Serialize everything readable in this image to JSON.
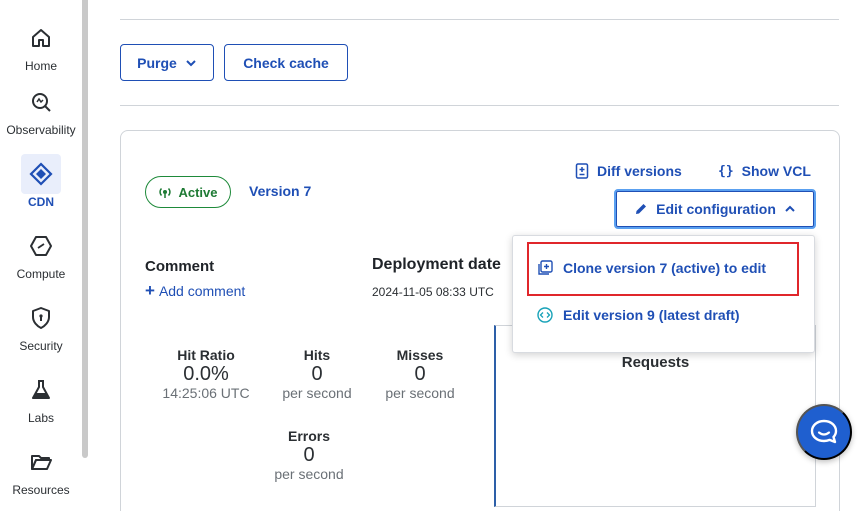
{
  "sidebar": {
    "items": [
      {
        "label": "Home",
        "icon": "home-icon"
      },
      {
        "label": "Observability",
        "icon": "magnifier-icon"
      },
      {
        "label": "CDN",
        "icon": "cdn-diamond-icon",
        "active": true
      },
      {
        "label": "Compute",
        "icon": "compute-hexagon-icon"
      },
      {
        "label": "Security",
        "icon": "shield-icon"
      },
      {
        "label": "Labs",
        "icon": "flask-icon"
      },
      {
        "label": "Resources",
        "icon": "folder-icon"
      }
    ]
  },
  "toolbar": {
    "purge_label": "Purge",
    "check_cache_label": "Check cache"
  },
  "service": {
    "status_label": "Active",
    "version_label": "Version 7",
    "diff_label": "Diff versions",
    "show_vcl_label": "Show VCL",
    "edit_config_label": "Edit configuration",
    "comment_title": "Comment",
    "add_comment_label": "Add comment",
    "deployment_title": "Deployment date",
    "deployment_value": "2024-11-05 08:33 UTC"
  },
  "dropdown": {
    "items": [
      {
        "label": "Clone version 7 (active) to edit",
        "icon": "clone-icon"
      },
      {
        "label": "Edit version 9 (latest draft)",
        "icon": "code-icon"
      }
    ]
  },
  "stats": {
    "hit_ratio": {
      "label": "Hit Ratio",
      "value": "0.0%",
      "sub": "14:25:06 UTC"
    },
    "hits": {
      "label": "Hits",
      "value": "0",
      "sub": "per second"
    },
    "misses": {
      "label": "Misses",
      "value": "0",
      "sub": "per second"
    },
    "errors": {
      "label": "Errors",
      "value": "0",
      "sub": "per second"
    }
  },
  "requests": {
    "title": "Requests"
  },
  "colors": {
    "accent": "#1f4fb5",
    "active_green": "#1e7a34",
    "highlight_red": "#e0262b",
    "chat": "#1f5fcf"
  }
}
